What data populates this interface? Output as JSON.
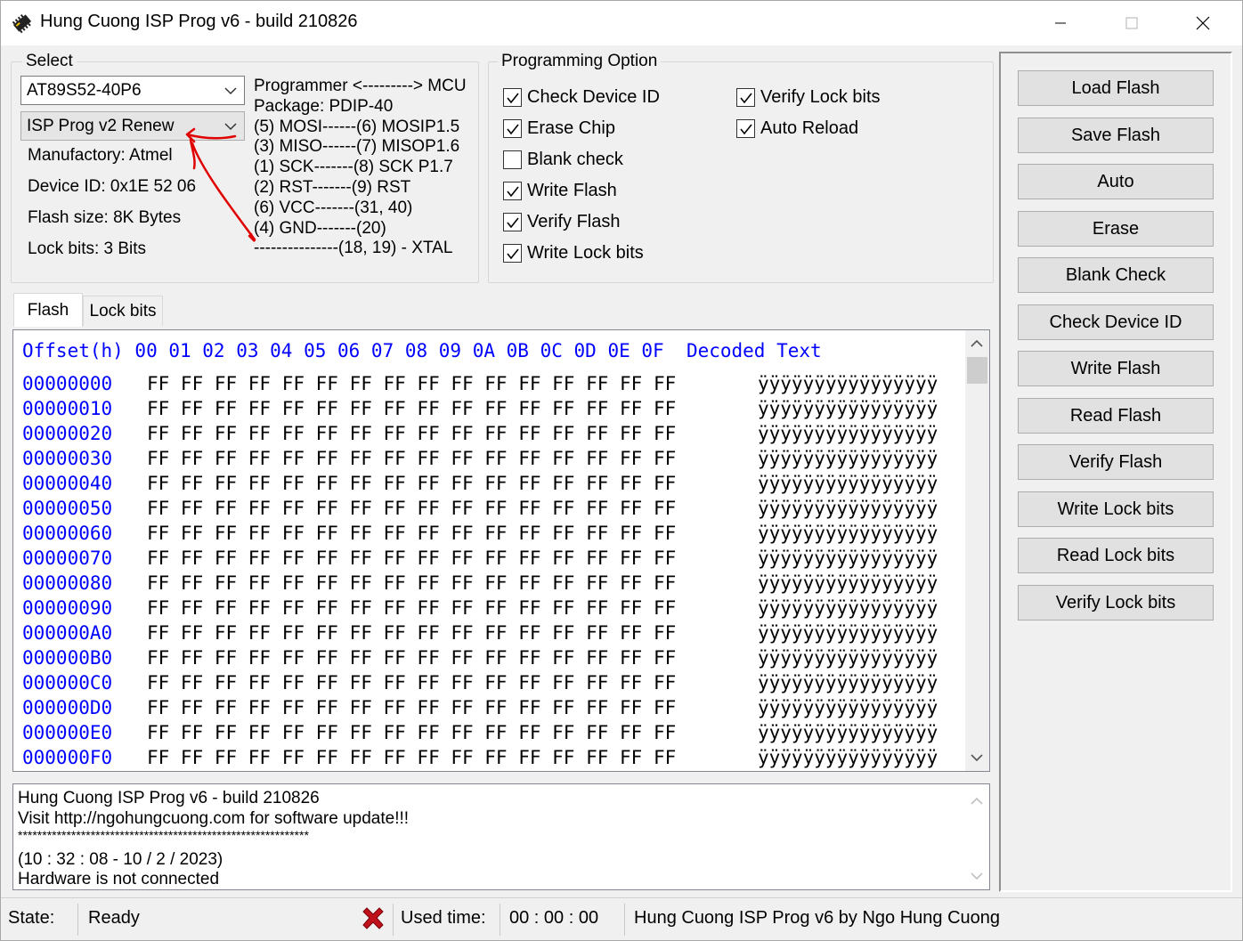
{
  "window": {
    "title": "Hung Cuong ISP Prog v6 - build 210826",
    "controls": [
      "minimize-icon",
      "maximize-icon",
      "close-icon"
    ]
  },
  "select_group": {
    "label": "Select",
    "chip_value": "AT89S52-40P6",
    "programmer_value": "ISP Prog v2 Renew",
    "manufactory": "Manufactory: Atmel",
    "device_id": "Device ID: 0x1E 52 06",
    "flash_size": "Flash size: 8K Bytes",
    "lock_bits": "Lock bits: 3 Bits",
    "pin_lines": [
      "Programmer <---------> MCU",
      "Package: PDIP-40",
      "(5) MOSI------(6) MOSIP1.5",
      "(3) MISO------(7) MISOP1.6",
      "(1) SCK-------(8) SCK P1.7",
      "(2) RST-------(9) RST",
      "(6) VCC-------(31, 40)",
      "(4) GND-------(20)",
      "---------------(18, 19) - XTAL"
    ]
  },
  "programming_option": {
    "label": "Programming Option",
    "left": [
      {
        "label": "Check Device ID",
        "checked": true
      },
      {
        "label": "Erase Chip",
        "checked": true
      },
      {
        "label": "Blank check",
        "checked": false
      },
      {
        "label": "Write Flash",
        "checked": true
      },
      {
        "label": "Verify Flash",
        "checked": true
      },
      {
        "label": "Write Lock bits",
        "checked": true
      }
    ],
    "right": [
      {
        "label": "Verify Lock bits",
        "checked": true
      },
      {
        "label": "Auto Reload",
        "checked": true
      }
    ]
  },
  "buttons": [
    "Load Flash",
    "Save Flash",
    "Auto",
    "Erase",
    "Blank Check",
    "Check Device ID",
    "Write Flash",
    "Read Flash",
    "Verify Flash",
    "Write Lock bits",
    "Read Lock bits",
    "Verify Lock bits"
  ],
  "tabs": [
    {
      "label": "Flash",
      "active": true
    },
    {
      "label": "Lock bits",
      "active": false
    }
  ],
  "hex": {
    "header": "Offset(h) 00 01 02 03 04 05 06 07 08 09 0A 0B 0C 0D 0E 0F  Decoded Text",
    "rows": [
      {
        "offset": "00000000",
        "bytes": "FF FF FF FF FF FF FF FF FF FF FF FF FF FF FF FF",
        "text": "ÿÿÿÿÿÿÿÿÿÿÿÿÿÿÿÿ"
      },
      {
        "offset": "00000010",
        "bytes": "FF FF FF FF FF FF FF FF FF FF FF FF FF FF FF FF",
        "text": "ÿÿÿÿÿÿÿÿÿÿÿÿÿÿÿÿ"
      },
      {
        "offset": "00000020",
        "bytes": "FF FF FF FF FF FF FF FF FF FF FF FF FF FF FF FF",
        "text": "ÿÿÿÿÿÿÿÿÿÿÿÿÿÿÿÿ"
      },
      {
        "offset": "00000030",
        "bytes": "FF FF FF FF FF FF FF FF FF FF FF FF FF FF FF FF",
        "text": "ÿÿÿÿÿÿÿÿÿÿÿÿÿÿÿÿ"
      },
      {
        "offset": "00000040",
        "bytes": "FF FF FF FF FF FF FF FF FF FF FF FF FF FF FF FF",
        "text": "ÿÿÿÿÿÿÿÿÿÿÿÿÿÿÿÿ"
      },
      {
        "offset": "00000050",
        "bytes": "FF FF FF FF FF FF FF FF FF FF FF FF FF FF FF FF",
        "text": "ÿÿÿÿÿÿÿÿÿÿÿÿÿÿÿÿ"
      },
      {
        "offset": "00000060",
        "bytes": "FF FF FF FF FF FF FF FF FF FF FF FF FF FF FF FF",
        "text": "ÿÿÿÿÿÿÿÿÿÿÿÿÿÿÿÿ"
      },
      {
        "offset": "00000070",
        "bytes": "FF FF FF FF FF FF FF FF FF FF FF FF FF FF FF FF",
        "text": "ÿÿÿÿÿÿÿÿÿÿÿÿÿÿÿÿ"
      },
      {
        "offset": "00000080",
        "bytes": "FF FF FF FF FF FF FF FF FF FF FF FF FF FF FF FF",
        "text": "ÿÿÿÿÿÿÿÿÿÿÿÿÿÿÿÿ"
      },
      {
        "offset": "00000090",
        "bytes": "FF FF FF FF FF FF FF FF FF FF FF FF FF FF FF FF",
        "text": "ÿÿÿÿÿÿÿÿÿÿÿÿÿÿÿÿ"
      },
      {
        "offset": "000000A0",
        "bytes": "FF FF FF FF FF FF FF FF FF FF FF FF FF FF FF FF",
        "text": "ÿÿÿÿÿÿÿÿÿÿÿÿÿÿÿÿ"
      },
      {
        "offset": "000000B0",
        "bytes": "FF FF FF FF FF FF FF FF FF FF FF FF FF FF FF FF",
        "text": "ÿÿÿÿÿÿÿÿÿÿÿÿÿÿÿÿ"
      },
      {
        "offset": "000000C0",
        "bytes": "FF FF FF FF FF FF FF FF FF FF FF FF FF FF FF FF",
        "text": "ÿÿÿÿÿÿÿÿÿÿÿÿÿÿÿÿ"
      },
      {
        "offset": "000000D0",
        "bytes": "FF FF FF FF FF FF FF FF FF FF FF FF FF FF FF FF",
        "text": "ÿÿÿÿÿÿÿÿÿÿÿÿÿÿÿÿ"
      },
      {
        "offset": "000000E0",
        "bytes": "FF FF FF FF FF FF FF FF FF FF FF FF FF FF FF FF",
        "text": "ÿÿÿÿÿÿÿÿÿÿÿÿÿÿÿÿ"
      },
      {
        "offset": "000000F0",
        "bytes": "FF FF FF FF FF FF FF FF FF FF FF FF FF FF FF FF",
        "text": "ÿÿÿÿÿÿÿÿÿÿÿÿÿÿÿÿ"
      }
    ]
  },
  "log": [
    "Hung Cuong ISP Prog v6 - build 210826",
    "Visit http://ngohungcuong.com for software update!!!",
    "************************************************************",
    "",
    "(10 : 32 : 08 - 10 / 2 / 2023)",
    "Hardware is not connected"
  ],
  "status": {
    "state_label": "State:",
    "state_value": "Ready",
    "status_icon": "error-x-icon",
    "used_time_label": "Used time:",
    "used_time_value": "00 : 00 : 00",
    "credit": "Hung Cuong ISP Prog v6 by Ngo Hung Cuong"
  },
  "colors": {
    "accent_blue": "#0000ff",
    "annotation_red": "#e00000",
    "error_red": "#c0101c"
  }
}
